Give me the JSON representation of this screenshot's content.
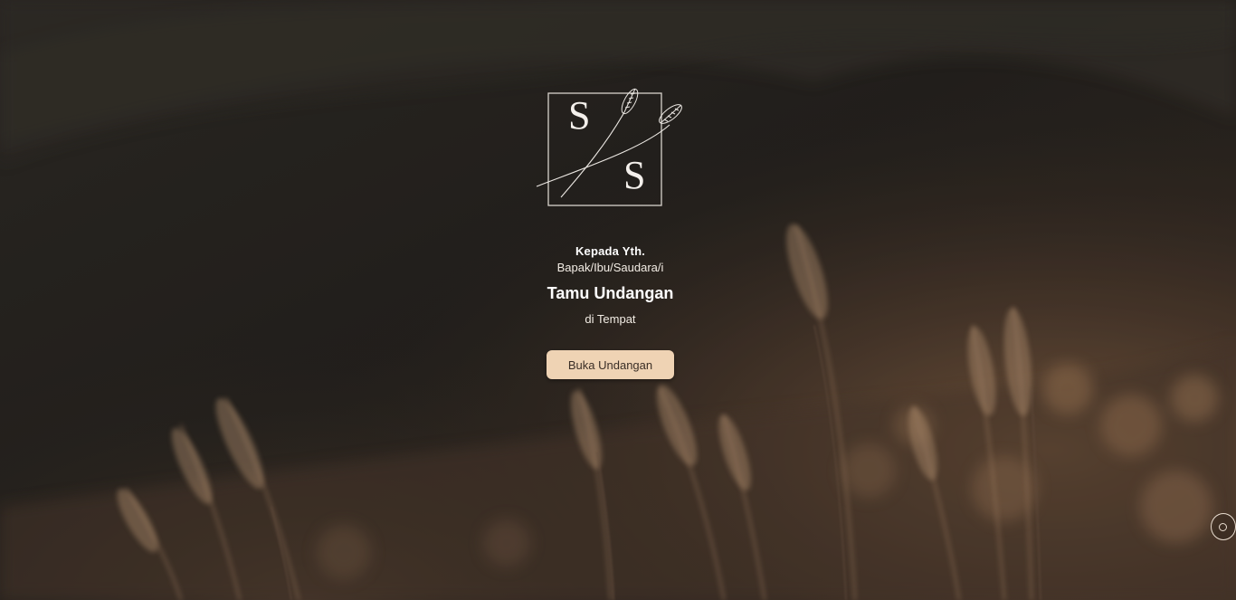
{
  "logo": {
    "initial_top": "S",
    "initial_bottom": "S",
    "icon": "wheat-monogram-icon"
  },
  "invitation": {
    "salutation": "Kepada Yth.",
    "addressee": "Bapak/Ibu/Saudara/i",
    "guest_name": "Tamu Undangan",
    "location": "di Tempat"
  },
  "buttons": {
    "open_label": "Buka Undangan",
    "music_icon": "music-disc-icon"
  },
  "colors": {
    "button_bg": "#efd3b4",
    "button_text": "#3a2e26",
    "text": "#ffffff",
    "background_dark": "#2a2622",
    "background_warm": "#7a5a40"
  }
}
